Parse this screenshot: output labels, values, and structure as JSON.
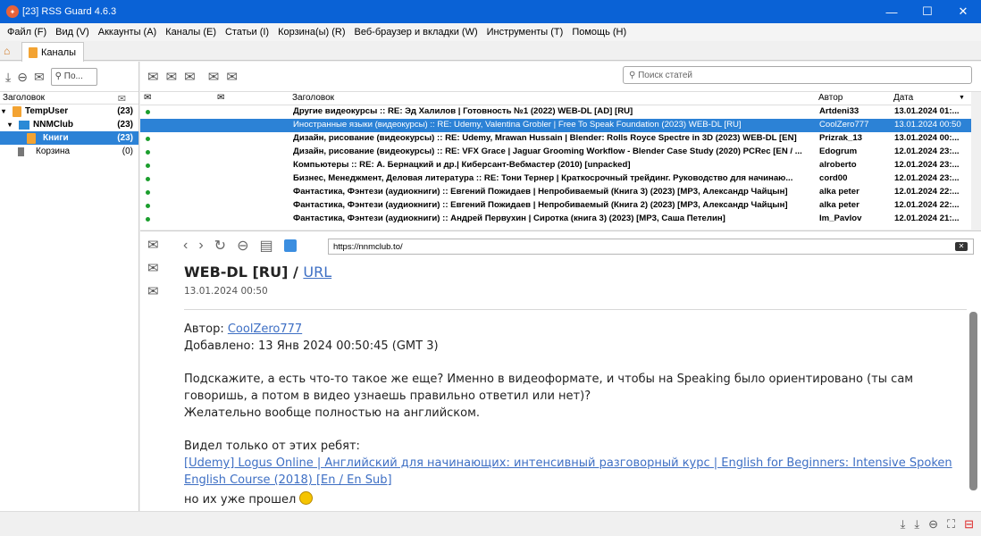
{
  "window": {
    "title": "[23] RSS Guard 4.6.3"
  },
  "menu": [
    "Файл (F)",
    "Вид (V)",
    "Аккаунты (A)",
    "Каналы (E)",
    "Статьи (I)",
    "Корзина(ы) (R)",
    "Веб-браузер и вкладки (W)",
    "Инструменты (T)",
    "Помощь (H)"
  ],
  "tab": {
    "label": "Каналы"
  },
  "feeds": {
    "search_placeholder": "По...",
    "header": "Заголовок",
    "items": [
      {
        "label": "TempUser",
        "count": "(23)"
      },
      {
        "label": "NNMClub",
        "count": "(23)"
      },
      {
        "label": "Книги",
        "count": "(23)"
      },
      {
        "label": "Корзина",
        "count": "(0)"
      }
    ]
  },
  "articles": {
    "search_placeholder": "Поиск статей",
    "columns": {
      "title": "Заголовок",
      "author": "Автор",
      "date": "Дата"
    },
    "rows": [
      {
        "title": "Другие видеокурсы :: RE: Эд Халилов | Готовность №1 (2022) WEB-DL [AD] [RU]",
        "author": "Artdeni33",
        "date": "13.01.2024 01:..."
      },
      {
        "title": "Иностранные языки (видеокурсы) :: RE: Udemy, Valentina Grobler | Free To Speak Foundation (2023) WEB-DL [RU]",
        "author": "CoolZero777",
        "date": "13.01.2024 00:50"
      },
      {
        "title": "Дизайн, рисование (видеокурсы) :: RE: Udemy, Mrawan Hussain | Blender: Rolls Royce Spectre in 3D (2023) WEB-DL [EN]",
        "author": "Prizrak_13",
        "date": "13.01.2024 00:..."
      },
      {
        "title": "Дизайн, рисование (видеокурсы) :: RE: VFX Grace | Jaguar Grooming Workflow - Blender Case Study (2020) PCRec [EN / ...",
        "author": "Edogrum",
        "date": "12.01.2024 23:..."
      },
      {
        "title": "Компьютеры :: RE: А. Бернацкий и др.| Киберсант-Вебмастер (2010) [unpacked]",
        "author": "alroberto",
        "date": "12.01.2024 23:..."
      },
      {
        "title": "Бизнес, Менеджмент, Деловая литература :: RE: Тони Тернер | Краткосрочный трейдинг. Руководство для начинаю...",
        "author": "cord00",
        "date": "12.01.2024 23:..."
      },
      {
        "title": "Фантастика, Фэнтези (аудиокниги) :: Евгений Пожидаев | Непробиваемый (Книга 3) (2023) [MP3, Александр Чайцын]",
        "author": "alka peter",
        "date": "12.01.2024 22:..."
      },
      {
        "title": "Фантастика, Фэнтези (аудиокниги) :: Евгений Пожидаев | Непробиваемый (Книга 2) (2023) [MP3, Александр Чайцын]",
        "author": "alka peter",
        "date": "12.01.2024 22:..."
      },
      {
        "title": "Фантастика, Фэнтези (аудиокниги) :: Андрей Первухин | Сиротка (книга 3) (2023) [MP3, Саша Петелин]",
        "author": "Im_Pavlov",
        "date": "12.01.2024 21:..."
      }
    ]
  },
  "preview": {
    "url": "https://nnmclub.to/",
    "title_text": "WEB-DL [RU] / ",
    "title_link": "URL",
    "date": "13.01.2024 00:50",
    "author_label": "Автор: ",
    "author": "CoolZero777",
    "added": "Добавлено: 13 Янв 2024 00:50:45 (GMT 3)",
    "p1": "Подскажите, а есть что-то такое же еще? Именно в видеоформате, и чтобы на Speaking было ориентировано (ты сам говоришь, а потом в видео узнаешь правильно ответил или нет)?",
    "p2": "Желательно вообще полностью на английском.",
    "p3": "Видел только от этих ребят:",
    "course_link": "[Udemy] Logus Online | Английский для начинающих: интенсивный разговорный курс | English for Beginners: Intensive Spoken English Course (2018) [En / En Sub]",
    "p4": "но их уже прошел"
  }
}
